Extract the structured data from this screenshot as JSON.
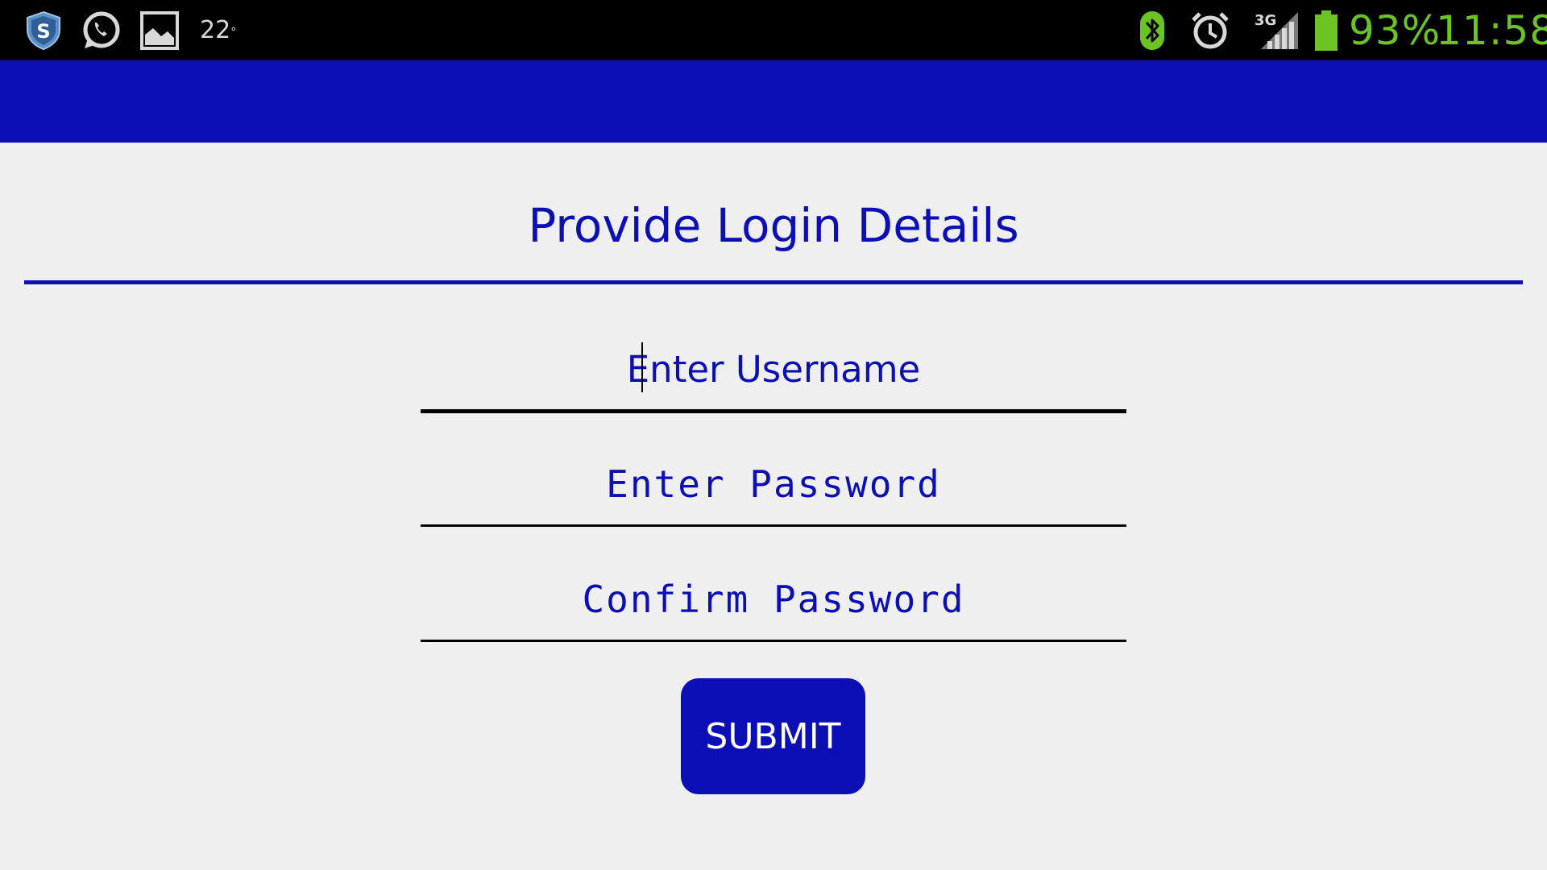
{
  "status_bar": {
    "temperature": "22",
    "temperature_unit": "°",
    "battery_percent": "93%",
    "time": "11:58",
    "network_label": "3G",
    "icons": [
      "shield-icon",
      "whatsapp-icon",
      "gallery-icon",
      "bluetooth-icon",
      "alarm-icon",
      "signal-icon",
      "battery-icon"
    ],
    "accent_color": "#6cc324"
  },
  "action_bar": {
    "color": "#0c0fb6"
  },
  "form": {
    "title": "Provide Login Details",
    "username_placeholder": "Enter Username",
    "password_placeholder": "Enter Password",
    "confirm_password_placeholder": "Confirm Password",
    "submit_label": "SUBMIT"
  },
  "colors": {
    "primary": "#0c0fb6",
    "background": "#efefef"
  }
}
